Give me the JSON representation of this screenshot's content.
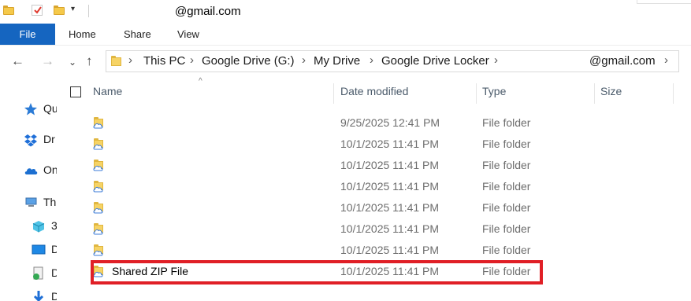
{
  "window": {
    "title": "@gmail.com"
  },
  "ribbon": {
    "tabs": [
      "File",
      "Home",
      "Share",
      "View"
    ]
  },
  "address": {
    "crumbs": [
      "This PC",
      "Google Drive (G:)",
      "My Drive",
      "Google Drive Locker",
      "@gmail.com"
    ]
  },
  "nav_pane": {
    "items": [
      {
        "label": "Qu",
        "icon": "star-icon"
      },
      {
        "label": "Dr",
        "icon": "dropbox-icon"
      },
      {
        "label": "On",
        "icon": "onedrive-cloud-icon"
      },
      {
        "label": "Th",
        "icon": "this-pc-icon"
      },
      {
        "label": "3",
        "icon": "3d-objects-icon"
      },
      {
        "label": "D",
        "icon": "desktop-icon"
      },
      {
        "label": "D",
        "icon": "documents-icon"
      },
      {
        "label": "D",
        "icon": "downloads-icon"
      }
    ]
  },
  "columns": {
    "name": "Name",
    "date": "Date modified",
    "type": "Type",
    "size": "Size"
  },
  "files": [
    {
      "name": "",
      "date": "9/25/2025 12:41 PM",
      "type": "File folder",
      "size": ""
    },
    {
      "name": "",
      "date": "10/1/2025 11:41 PM",
      "type": "File folder",
      "size": ""
    },
    {
      "name": "",
      "date": "10/1/2025 11:41 PM",
      "type": "File folder",
      "size": ""
    },
    {
      "name": "",
      "date": "10/1/2025 11:41 PM",
      "type": "File folder",
      "size": ""
    },
    {
      "name": "",
      "date": "10/1/2025 11:41 PM",
      "type": "File folder",
      "size": ""
    },
    {
      "name": "",
      "date": "10/1/2025 11:41 PM",
      "type": "File folder",
      "size": ""
    },
    {
      "name": "",
      "date": "10/1/2025 11:41 PM",
      "type": "File folder",
      "size": ""
    },
    {
      "name": "Shared ZIP File",
      "date": "10/1/2025 11:41 PM",
      "type": "File folder",
      "size": ""
    }
  ],
  "colors": {
    "accent": "#1565c0",
    "highlight": "#e01f26",
    "folder": "#f6d365"
  }
}
